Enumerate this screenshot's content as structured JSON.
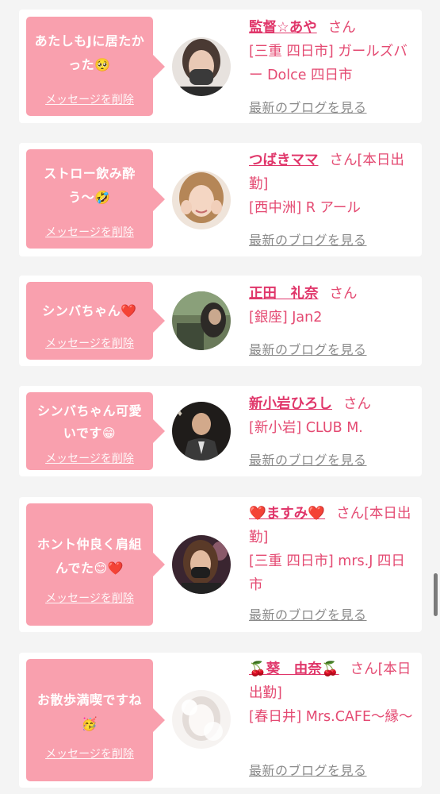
{
  "cards": [
    {
      "message": "あたしもJに居たかった🥺",
      "delete_label": "メッセージを削除",
      "name": "監督☆あや",
      "honorific": "さん",
      "shop": "[三重 四日市] ガールズバー Dolce 四日市",
      "blog_label": "最新のブログを見る"
    },
    {
      "message": "ストロー飲み酔う〜🤣",
      "delete_label": "メッセージを削除",
      "name": "つばきママ",
      "honorific": "さん[本日出勤]",
      "shop": "[西中洲] R アール",
      "blog_label": "最新のブログを見る"
    },
    {
      "message": "シンバちゃん❤️",
      "delete_label": "メッセージを削除",
      "name": "正田　礼奈",
      "honorific": "さん",
      "shop": "[銀座] Jan2",
      "blog_label": "最新のブログを見る"
    },
    {
      "message": "シンバちゃん可愛いです😁",
      "delete_label": "メッセージを削除",
      "name": "新小岩ひろし",
      "honorific": "さん",
      "shop": "[新小岩] CLUB M.",
      "blog_label": "最新のブログを見る"
    },
    {
      "message": "ホント仲良く肩組んでた😊❤️",
      "delete_label": "メッセージを削除",
      "name": "❤️ますみ❤️",
      "honorific": "さん[本日出勤]",
      "shop": "[三重 四日市] mrs.J 四日市",
      "blog_label": "最新のブログを見る"
    },
    {
      "message": "お散歩満喫ですね🥳",
      "delete_label": "メッセージを削除",
      "name": "🍒葵　由奈🍒",
      "honorific": "さん[本日出勤]",
      "shop": "[春日井] Mrs.CAFE〜縁〜",
      "blog_label": "最新のブログを見る"
    }
  ],
  "colors": {
    "bubble": "#f9a0ae",
    "name": "#e0366a",
    "text": "#e44a72",
    "blog": "#8a8a8a",
    "background": "#f4f4f4"
  }
}
